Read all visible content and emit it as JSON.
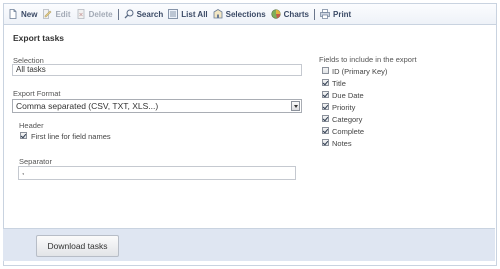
{
  "toolbar": {
    "new": "New",
    "edit": "Edit",
    "delete": "Delete",
    "search": "Search",
    "list_all": "List All",
    "selections": "Selections",
    "charts": "Charts",
    "print": "Print"
  },
  "page_title": "Export tasks",
  "selection": {
    "label": "Selection",
    "value": "All tasks"
  },
  "export_format": {
    "label": "Export Format",
    "value": "Comma separated (CSV, TXT, XLS...)"
  },
  "header": {
    "label": "Header",
    "option_label": "First line for field names",
    "checked": true
  },
  "separator": {
    "label": "Separator",
    "value": ","
  },
  "fields": {
    "label": "Fields to include in the export",
    "items": [
      {
        "label": "ID (Primary Key)",
        "checked": false
      },
      {
        "label": "Title",
        "checked": true
      },
      {
        "label": "Due Date",
        "checked": true
      },
      {
        "label": "Priority",
        "checked": true
      },
      {
        "label": "Category",
        "checked": true
      },
      {
        "label": "Complete",
        "checked": true
      },
      {
        "label": "Notes",
        "checked": true
      }
    ]
  },
  "download_button": "Download tasks",
  "colors": {
    "toolbar_text": "#3b4a66",
    "footer_bg": "#dfe6f2",
    "border": "#c9d3e0"
  }
}
